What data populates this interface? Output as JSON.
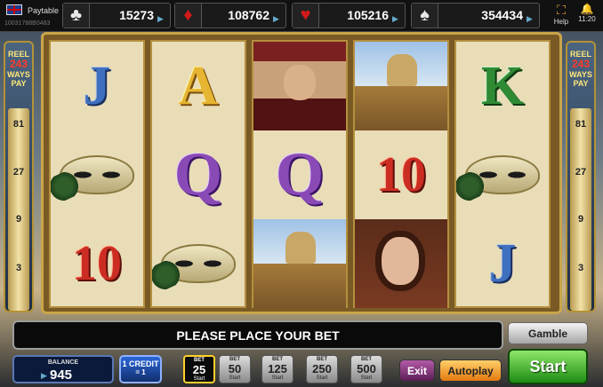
{
  "header": {
    "paytable_label": "Paytable",
    "serial": "10031788B0483",
    "help_label": "Help",
    "time": "11:20"
  },
  "jackpots": [
    {
      "suit": "clubs",
      "symbol": "♣",
      "amount": "15273"
    },
    {
      "suit": "diamonds",
      "symbol": "♦",
      "amount": "108762"
    },
    {
      "suit": "hearts",
      "symbol": "♥",
      "amount": "105216"
    },
    {
      "suit": "spades",
      "symbol": "♠",
      "amount": "354434"
    }
  ],
  "side_panel": {
    "reel_label": "REEL",
    "ways_count": "243",
    "ways_label": "WAYS",
    "pay_label": "PAY",
    "ways_steps": [
      "81",
      "27",
      "9",
      "3"
    ]
  },
  "reels": [
    [
      "J",
      "mask-icon",
      "10"
    ],
    [
      "A",
      "Q",
      "mask-icon"
    ],
    [
      "nobleman-icon",
      "Q",
      "lion-column-icon"
    ],
    [
      "lion-column-icon",
      "10",
      "noblewoman-icon"
    ],
    [
      "K",
      "mask-icon",
      "J"
    ]
  ],
  "message": "PLEASE PLACE YOUR BET",
  "buttons": {
    "gamble": "Gamble",
    "exit": "Exit",
    "autoplay": "Autoplay",
    "start": "Start"
  },
  "balance": {
    "label": "BALANCE",
    "value": "945"
  },
  "credit": {
    "line1": "1 CREDIT",
    "line2": "= 1"
  },
  "bets": [
    {
      "top": "BET",
      "value": "25",
      "bottom": "Start",
      "active": true
    },
    {
      "top": "BET",
      "value": "50",
      "bottom": "Start",
      "active": false
    },
    {
      "top": "BET",
      "value": "125",
      "bottom": "Start",
      "active": false
    },
    {
      "top": "BET",
      "value": "250",
      "bottom": "Start",
      "active": false
    },
    {
      "top": "BET",
      "value": "500",
      "bottom": "Start",
      "active": false
    }
  ]
}
